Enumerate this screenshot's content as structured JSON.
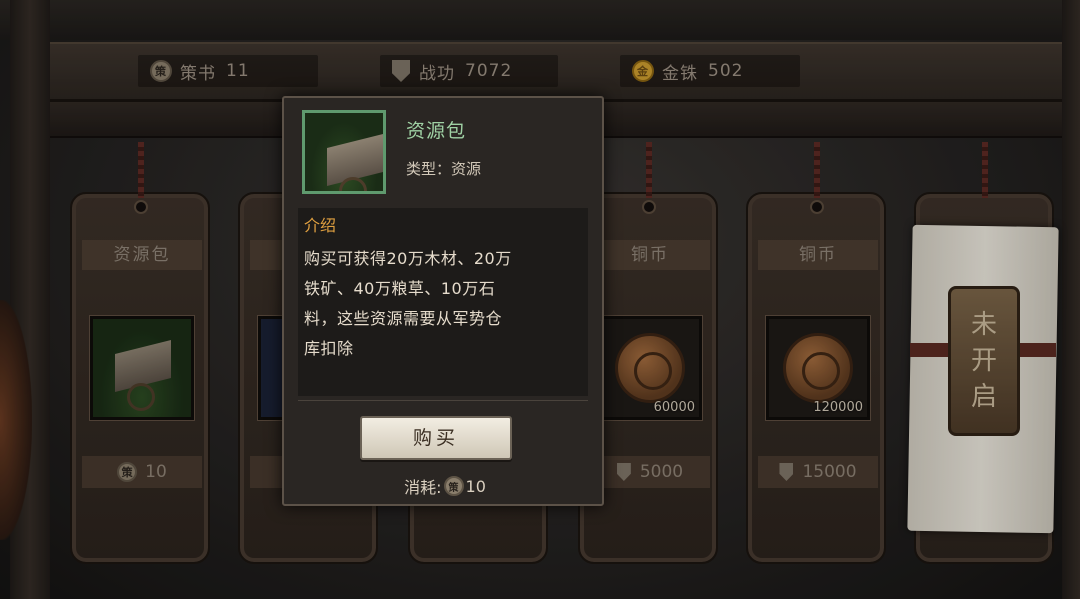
{
  "currencies": [
    {
      "icon": "policy-book-icon",
      "glyph": "策",
      "label": "策书",
      "value": "11"
    },
    {
      "icon": "merit-shield-icon",
      "label": "战功",
      "value": "7072"
    },
    {
      "icon": "gold-coin-icon",
      "glyph": "金",
      "label": "金铢",
      "value": "502"
    }
  ],
  "cards": [
    {
      "name": "资源包",
      "price_icon_glyph": "策",
      "price": "10"
    },
    {
      "name": "",
      "price": ""
    },
    {
      "name": "",
      "price": ""
    },
    {
      "name": "铜币",
      "quantity": "60000",
      "price": "5000"
    },
    {
      "name": "铜币",
      "quantity": "120000",
      "price": "15000"
    }
  ],
  "locked_slot": {
    "label_lines": [
      "未",
      "开",
      "启"
    ]
  },
  "popup": {
    "item_name": "资源包",
    "item_type": "类型：资源",
    "desc_heading": "介绍",
    "desc_lines": [
      "购买可获得20万木材、20万",
      "铁矿、40万粮草、10万石",
      "料，这些资源需要从军势仓",
      "库扣除"
    ],
    "buy_label": "购买",
    "cost_label": "消耗:",
    "cost_icon_glyph": "策",
    "cost_value": "10"
  },
  "colors": {
    "item_name": "#9fd1a4",
    "desc_heading": "#e0a040",
    "item_frame": "#5f9a6e"
  }
}
